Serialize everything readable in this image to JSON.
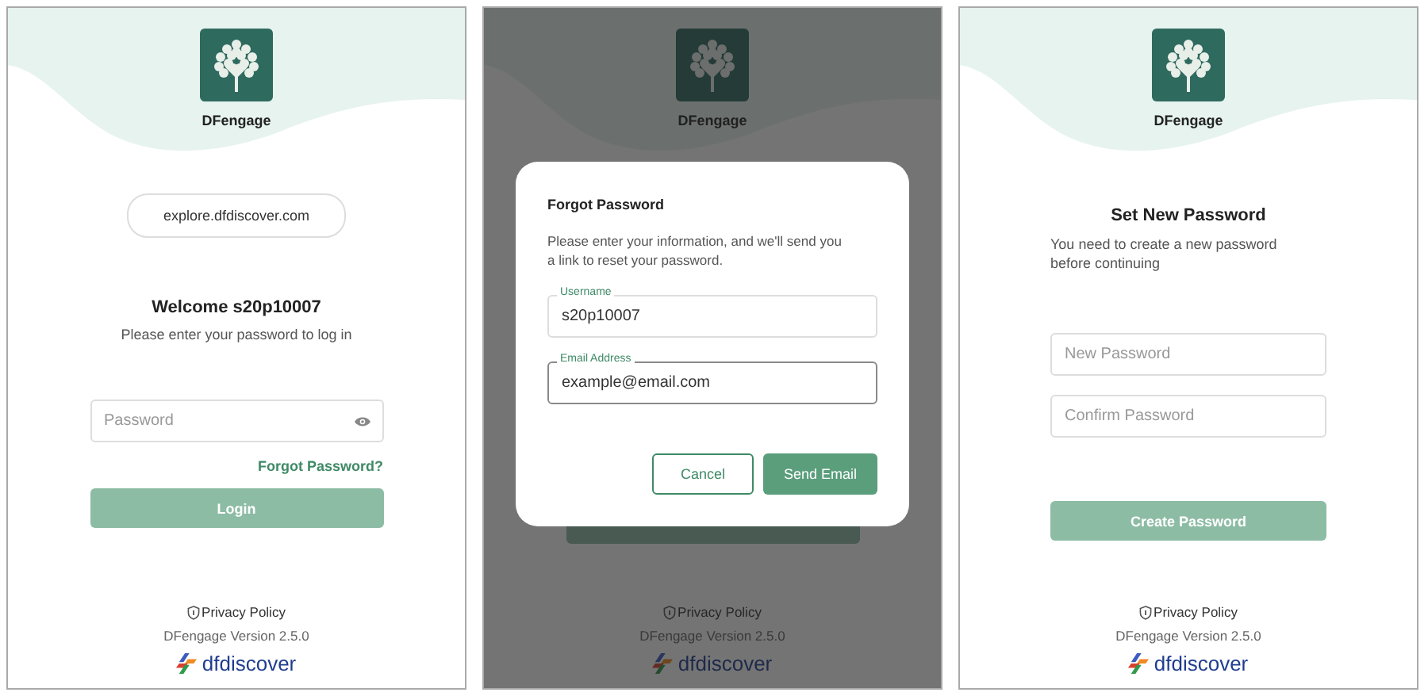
{
  "screens": [
    {
      "kind": "login",
      "app_name": "DFengage",
      "server": "explore.dfdiscover.com",
      "heading": "Welcome s20p10007",
      "subtitle": "Please enter your password to log in",
      "password": {
        "placeholder": "Password"
      },
      "forgot_link": "Forgot Password?",
      "button": {
        "label": "Login",
        "disabled": true
      },
      "footer": {
        "privacy": "Privacy Policy",
        "version": "DFengage Version 2.5.0",
        "brand": "dfdiscover"
      }
    },
    {
      "kind": "dialog",
      "app_name": "DFengage",
      "dialog": {
        "title": "Forgot Password",
        "text": "Please enter your information, and we'll send you a link to reset your password.",
        "fields": [
          {
            "label": "Username",
            "value": "s20p10007",
            "focused": false
          },
          {
            "label": "Email Address",
            "value": "example@email.com",
            "focused": true
          }
        ],
        "buttons": [
          {
            "label": "Cancel",
            "kind": "outline"
          },
          {
            "label": "Send Email",
            "kind": "primary"
          }
        ]
      },
      "footer": {
        "privacy": "Privacy Policy",
        "version": "DFengage Version 2.5.0",
        "brand": "dfdiscover"
      }
    },
    {
      "kind": "set_password",
      "app_name": "DFengage",
      "heading": "Set New Password",
      "subtitle": "You need to create a new password before continuing",
      "fields": [
        {
          "placeholder": "New Password"
        },
        {
          "placeholder": "Confirm Password"
        }
      ],
      "button": {
        "label": "Create Password",
        "disabled": true
      },
      "footer": {
        "privacy": "Privacy Policy",
        "version": "DFengage Version 2.5.0",
        "brand": "dfdiscover"
      }
    }
  ]
}
